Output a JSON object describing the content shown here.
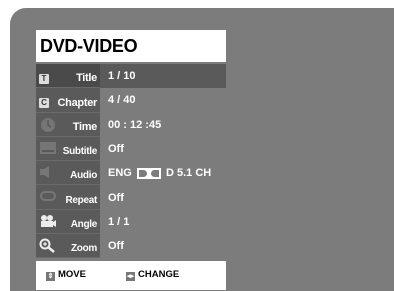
{
  "header": {
    "title": "DVD-VIDEO"
  },
  "rows": [
    {
      "label": "Title",
      "value": "1 / 10",
      "icon": "title-icon",
      "selected": true
    },
    {
      "label": "Chapter",
      "value": "4 / 40",
      "icon": "chapter-icon"
    },
    {
      "label": "Time",
      "value": "00 : 12 :45",
      "icon": "clock-icon"
    },
    {
      "label": "Subtitle",
      "value": "Off",
      "icon": "subtitle-icon"
    },
    {
      "label": "Audio",
      "value_prefix": "ENG",
      "value_suffix": "D 5.1 CH",
      "icon": "speaker-icon"
    },
    {
      "label": "Repeat",
      "value": "Off",
      "icon": "repeat-icon"
    },
    {
      "label": "Angle",
      "value": "1 / 1",
      "icon": "camera-angle-icon"
    },
    {
      "label": "Zoom",
      "value": "Off",
      "icon": "zoom-icon"
    }
  ],
  "footer": {
    "move_label": "MOVE",
    "change_label": "CHANGE"
  },
  "colors": {
    "background": "#7c7c7c",
    "panel": "#5a5a5a",
    "text": "#ffffff"
  }
}
